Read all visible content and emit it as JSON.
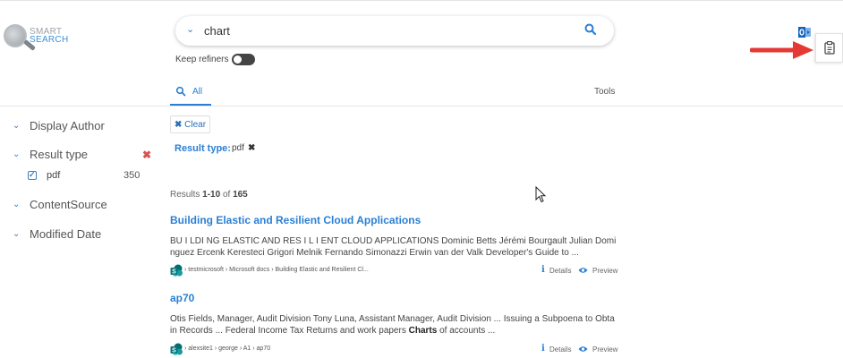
{
  "logo": {
    "line1": "SMART",
    "line2": "SEARCH"
  },
  "search": {
    "query": "chart",
    "keep_refiners_label": "Keep refiners"
  },
  "tabs": {
    "all": "All",
    "tools": "Tools"
  },
  "sidebar": {
    "display_author": "Display Author",
    "result_type": "Result type",
    "result_type_option": {
      "label": "pdf",
      "count": "350",
      "checked": true
    },
    "content_source": "ContentSource",
    "modified_date": "Modified Date"
  },
  "filters": {
    "clear_label": "Clear",
    "active_title": "Result type:",
    "active_value": "pdf"
  },
  "results_summary": {
    "prefix": "Results",
    "range": "1-10",
    "of": "of",
    "total": "165"
  },
  "results": [
    {
      "title": "Building Elastic and Resilient Cloud Applications",
      "snippet_line1": "BU I LDI NG ELASTIC AND RES I L I ENT CLOUD APPLICATIONS Dominic Betts Jérémi Bourgault Julian Domi",
      "snippet_line2": "nguez Ercenk Keresteci Grigori Melnik Fernando Simonazzi Erwin van der Valk Developer's Guide to ...",
      "path": "› testmicrosoft › Microsoft docs › Building Elastic and Resilient Cl...",
      "details_label": "Details",
      "preview_label": "Preview"
    },
    {
      "title": "ap70",
      "snippet_line1": "Otis Fields, Manager, Audit Division Tony Luna, Assistant Manager, Audit Division ... Issuing a Subpoena to Obta",
      "snippet_line2_pre": "in Records ... Federal Income Tax Returns and work papers ",
      "snippet_line2_bold": "Charts",
      "snippet_line2_post": " of accounts ...",
      "path": "› alexsite1 › george › A1 › ap70",
      "details_label": "Details",
      "preview_label": "Preview"
    }
  ],
  "colors": {
    "accent": "#2a7fd4",
    "arrow": "#e53935",
    "sharepoint": "#036c70"
  },
  "icons": [
    "search-icon",
    "chevron-down-icon",
    "outlook-icon",
    "clipboard-icon",
    "arrow-icon",
    "check-icon",
    "close-icon",
    "sharepoint-icon",
    "info-icon",
    "eye-icon",
    "cursor-icon"
  ]
}
